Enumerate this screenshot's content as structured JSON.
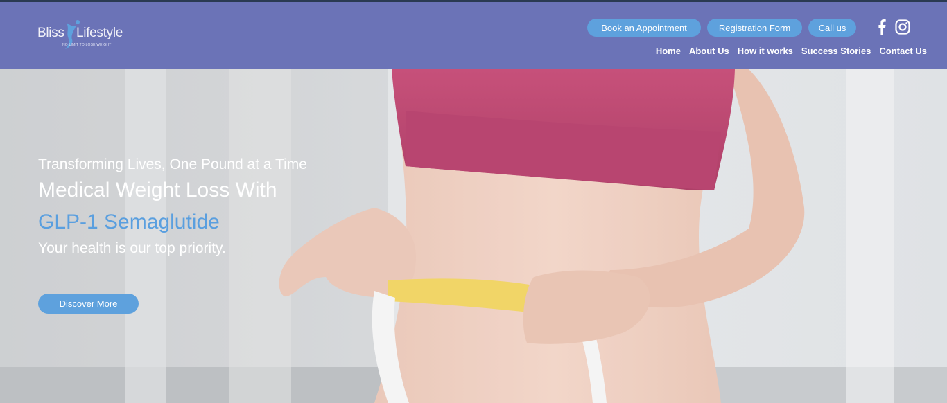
{
  "logo": {
    "word1": "Bliss",
    "word2": "Lifestyle",
    "tagline": "NO LIMIT TO LOSE WEIGHT"
  },
  "header_buttons": {
    "appointment": "Book an Appointment",
    "registration": "Registration Form",
    "call": "Call us"
  },
  "social": {
    "facebook_icon": "facebook-icon",
    "instagram_icon": "instagram-icon"
  },
  "nav": {
    "items": [
      "Home",
      "About Us",
      "How it works",
      "Success Stories",
      "Contact Us"
    ]
  },
  "hero": {
    "tagline": "Transforming Lives, One Pound at a Time",
    "title_line1": "Medical Weight Loss With",
    "title_line2": "GLP-1 Semaglutide",
    "subtitle": "Your health is our top priority.",
    "cta": "Discover More"
  },
  "colors": {
    "header_bg": "#6b73b7",
    "accent_blue": "#5ea1dd",
    "top_strip": "#2a3a52"
  }
}
